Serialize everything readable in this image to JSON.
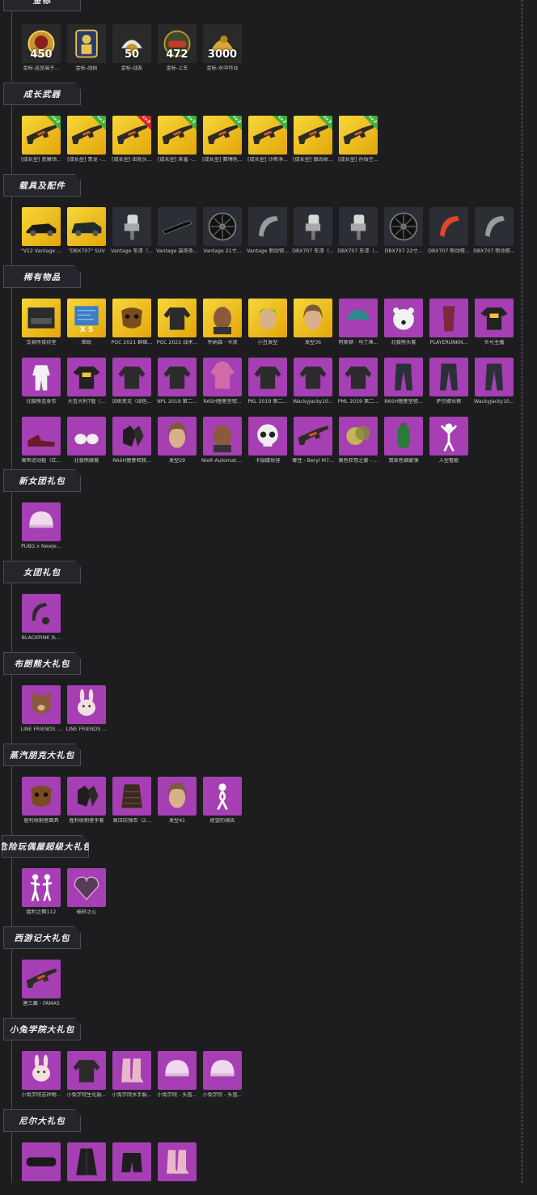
{
  "sections": [
    {
      "id": "s0",
      "title": "金标",
      "items": [
        {
          "caption": "金标-这是属于...",
          "count": "450",
          "icon": "medal-icon"
        },
        {
          "caption": "金标-战损",
          "count": "",
          "icon": "soldier-medal-icon"
        },
        {
          "caption": "金标-战友",
          "count": "50",
          "icon": "bird-medal-icon"
        },
        {
          "caption": "金标-上车",
          "count": "472",
          "icon": "car-medal-icon"
        },
        {
          "caption": "金标-水中作业",
          "count": "3000",
          "icon": "duck-medal-icon"
        }
      ]
    },
    {
      "id": "s1",
      "title": "成长武器",
      "items": [
        {
          "caption": "[成长型] 恶魔领...",
          "badge": "Lv.2",
          "badge_color": "green",
          "icon": "rifle-icon"
        },
        {
          "caption": "[成长型] 青龙 -...",
          "badge": "Lv.1",
          "badge_color": "green",
          "icon": "rifle-icon"
        },
        {
          "caption": "[成长型] 齿轮头...",
          "badge": "Lv.8",
          "badge_color": "red",
          "icon": "rifle-icon"
        },
        {
          "caption": "[成长型] 朱雀 -...",
          "badge": "Lv.1",
          "badge_color": "green",
          "icon": "rifle-icon"
        },
        {
          "caption": "[成长型] 赛博危...",
          "badge": "Lv.2",
          "badge_color": "green",
          "icon": "rifle-icon"
        },
        {
          "caption": "[成长型] 沙怖净...",
          "badge": "Lv.2",
          "badge_color": "green",
          "icon": "rifle-icon"
        },
        {
          "caption": "[成长型] 银齿收...",
          "badge": "Lv.3",
          "badge_color": "green",
          "icon": "rifle-icon"
        },
        {
          "caption": "[成长型] 孙悟空...",
          "badge": "Lv.2",
          "badge_color": "green",
          "icon": "rifle-icon"
        }
      ]
    },
    {
      "id": "s2",
      "title": "载具及配件",
      "items": [
        {
          "caption": "\"V12 Vantage ...",
          "bg": "gold",
          "icon": "car-icon"
        },
        {
          "caption": "\"DBX707\" SUV",
          "bg": "gold",
          "icon": "suv-icon"
        },
        {
          "caption": "Vantage 车漆（...",
          "bg": "dark",
          "icon": "paint-gun-icon"
        },
        {
          "caption": "Vantage 装饰条...",
          "bg": "dark",
          "icon": "trim-icon"
        },
        {
          "caption": "Vantage 21寸...",
          "bg": "dark",
          "icon": "wheel-icon"
        },
        {
          "caption": "Vantage 制动钳...",
          "bg": "dark",
          "icon": "caliper-icon"
        },
        {
          "caption": "DBX707 车漆（...",
          "bg": "dark",
          "icon": "paint-gun-icon"
        },
        {
          "caption": "DBX707 车漆（...",
          "bg": "dark",
          "icon": "paint-gun-icon"
        },
        {
          "caption": "DBX707 22寸...",
          "bg": "dark",
          "icon": "wheel-icon"
        },
        {
          "caption": "DBX707 制动钳...",
          "bg": "dark",
          "icon": "caliper-red-icon"
        },
        {
          "caption": "DBX707 制动钳...",
          "bg": "dark",
          "icon": "caliper-icon"
        }
      ]
    },
    {
      "id": "s3",
      "title": "稀有物品",
      "items": [
        {
          "caption": "交易所接待室",
          "bg": "gold",
          "icon": "room-icon"
        },
        {
          "caption": "图纸",
          "bg": "gold",
          "icon": "blueprint-icon",
          "count": "X 5"
        },
        {
          "caption": "PGC 2021 群雄...",
          "bg": "gold",
          "icon": "mask-icon"
        },
        {
          "caption": "PGC 2022 战术...",
          "bg": "gold",
          "icon": "jacket-icon"
        },
        {
          "caption": "乔纳森 · 卡茂",
          "bg": "gold",
          "icon": "face-icon"
        },
        {
          "caption": "小丑发型",
          "bg": "gold",
          "icon": "hair-green-icon"
        },
        {
          "caption": "发型36",
          "bg": "gold",
          "icon": "hair-icon"
        },
        {
          "caption": "阿斯顿 · 马丁渔...",
          "bg": "purple",
          "icon": "bucket-hat-icon"
        },
        {
          "caption": "北极熊头套",
          "bg": "purple",
          "icon": "bear-head-icon"
        },
        {
          "caption": "PLAYERUNKN...",
          "bg": "purple",
          "icon": "scarf-icon"
        },
        {
          "caption": "头号主播",
          "bg": "purple",
          "icon": "tshirt-icon"
        },
        {
          "caption": "北极熊连身衣",
          "bg": "purple",
          "icon": "jumpsuit-icon"
        },
        {
          "caption": "大吉大利T恤（...",
          "bg": "purple",
          "icon": "tshirt-icon"
        },
        {
          "caption": "训练夹克（绿色...",
          "bg": "purple",
          "icon": "jacket-icon"
        },
        {
          "caption": "NPL 2019 第二...",
          "bg": "purple",
          "icon": "jacket-icon"
        },
        {
          "caption": "RASH惬意坚韧...",
          "bg": "purple",
          "icon": "hoodie-icon"
        },
        {
          "caption": "PKL 2019 第二...",
          "bg": "purple",
          "icon": "jacket-icon"
        },
        {
          "caption": "WackyJacky10...",
          "bg": "purple",
          "icon": "jacket-icon"
        },
        {
          "caption": "PML 2019 第二...",
          "bg": "purple",
          "icon": "jacket-icon"
        },
        {
          "caption": "RASH惬意坚韧...",
          "bg": "purple",
          "icon": "pants-icon"
        },
        {
          "caption": "萨芬娜长裤",
          "bg": "purple",
          "icon": "pants-icon"
        },
        {
          "caption": "WackyJacky10...",
          "bg": "purple",
          "icon": "pants-icon"
        },
        {
          "caption": "高帮运动鞋（红...",
          "bg": "purple",
          "icon": "shoes-icon"
        },
        {
          "caption": "北极熊脚套",
          "bg": "purple",
          "icon": "paws-icon"
        },
        {
          "caption": "RASH惬意和我...",
          "bg": "purple",
          "icon": "gloves-icon"
        },
        {
          "caption": "发型29",
          "bg": "purple",
          "icon": "hair-icon"
        },
        {
          "caption": "NieR Automata...",
          "bg": "purple",
          "icon": "face-icon"
        },
        {
          "caption": "卡骷髅妆容",
          "bg": "purple",
          "icon": "skull-icon"
        },
        {
          "caption": "毒性 - Beryl M7...",
          "bg": "purple",
          "icon": "rifle-icon"
        },
        {
          "caption": "黄色狂怒之雾 - ...",
          "bg": "purple",
          "icon": "smoke-icon"
        },
        {
          "caption": "翡翠色烟雾弹",
          "bg": "purple",
          "icon": "grenade-icon"
        },
        {
          "caption": "人型看板",
          "bg": "purple",
          "icon": "figure-icon"
        }
      ]
    },
    {
      "id": "s4",
      "title": "新女团礼包",
      "items": [
        {
          "caption": "PUBG x NewJe...",
          "bg": "purple",
          "icon": "helmet-icon"
        }
      ]
    },
    {
      "id": "s5",
      "title": "女团礼包",
      "items": [
        {
          "caption": "BLACKPINK 头...",
          "bg": "purple",
          "icon": "headset-icon"
        }
      ]
    },
    {
      "id": "s6",
      "title": "布朗熊大礼包",
      "items": [
        {
          "caption": "LINE FRIENDS ...",
          "bg": "purple",
          "icon": "bear-icon"
        },
        {
          "caption": "LINE FRIENDS ...",
          "bg": "purple",
          "icon": "bunny-icon"
        }
      ]
    },
    {
      "id": "s7",
      "title": "蒸汽朋克大礼包",
      "items": [
        {
          "caption": "胜利收割者面具",
          "bg": "purple",
          "icon": "mask-icon"
        },
        {
          "caption": "胜利收割者手套",
          "bg": "purple",
          "icon": "gloves-icon"
        },
        {
          "caption": "高压防弹衣（2...",
          "bg": "purple",
          "icon": "vest-icon"
        },
        {
          "caption": "发型41",
          "bg": "purple",
          "icon": "hair-icon"
        },
        {
          "caption": "绝望的祷告",
          "bg": "purple",
          "icon": "emote-icon"
        }
      ]
    },
    {
      "id": "s8",
      "title": "危险玩偶屋超级大礼包",
      "wide": true,
      "items": [
        {
          "caption": "胜利之舞112",
          "bg": "purple",
          "icon": "dance-icon"
        },
        {
          "caption": "破碎之心",
          "bg": "purple",
          "icon": "heart-icon"
        }
      ]
    },
    {
      "id": "s9",
      "title": "西游记大礼包",
      "items": [
        {
          "caption": "唐三藏 - FAMAS",
          "bg": "purple",
          "icon": "rifle-icon"
        }
      ]
    },
    {
      "id": "s10",
      "title": "小兔学院大礼包",
      "items": [
        {
          "caption": "小兔学院吉祥物...",
          "bg": "purple",
          "icon": "bunny-icon"
        },
        {
          "caption": "小兔学院生化服...",
          "bg": "purple",
          "icon": "jacket-icon"
        },
        {
          "caption": "小兔学院水手服...",
          "bg": "purple",
          "icon": "boots-icon"
        },
        {
          "caption": "小兔学院 - 头盔...",
          "bg": "purple",
          "icon": "helmet-icon"
        },
        {
          "caption": "小兔学院 - 头盔...",
          "bg": "purple",
          "icon": "helmet-icon"
        }
      ]
    },
    {
      "id": "s11",
      "title": "尼尔大礼包",
      "items": [
        {
          "caption": "",
          "bg": "purple",
          "icon": "blindfold-icon"
        },
        {
          "caption": "",
          "bg": "purple",
          "icon": "coat-icon"
        },
        {
          "caption": "",
          "bg": "purple",
          "icon": "shorts-icon"
        },
        {
          "caption": "",
          "bg": "purple",
          "icon": "boots-icon"
        }
      ]
    }
  ]
}
